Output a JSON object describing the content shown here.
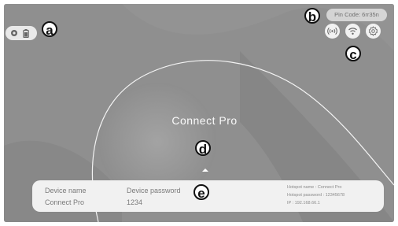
{
  "app": {
    "title": "Connect Pro"
  },
  "pin_code": "Pin Code: 6rr35n",
  "device": {
    "name_label": "Device name",
    "name_value": "Connect Pro",
    "password_label": "Device password",
    "password_value": "1234"
  },
  "hotspot": {
    "name": "Hotspot name : Connect Pro",
    "password": "Hotspot password : 12345678",
    "ip": "IP : 192.168.66.1"
  },
  "callouts": {
    "a": "a",
    "b": "b",
    "c": "c",
    "d": "d",
    "e": "e"
  },
  "icons": {
    "top_left": [
      "location-icon",
      "battery-icon"
    ],
    "top_right": [
      "hotspot-icon",
      "wifi-icon",
      "settings-icon"
    ],
    "bottom": "caret-up-icon"
  },
  "colors": {
    "background": "#8d8d8d",
    "panel": "#f1f1f1",
    "text_light": "#fafafa"
  }
}
